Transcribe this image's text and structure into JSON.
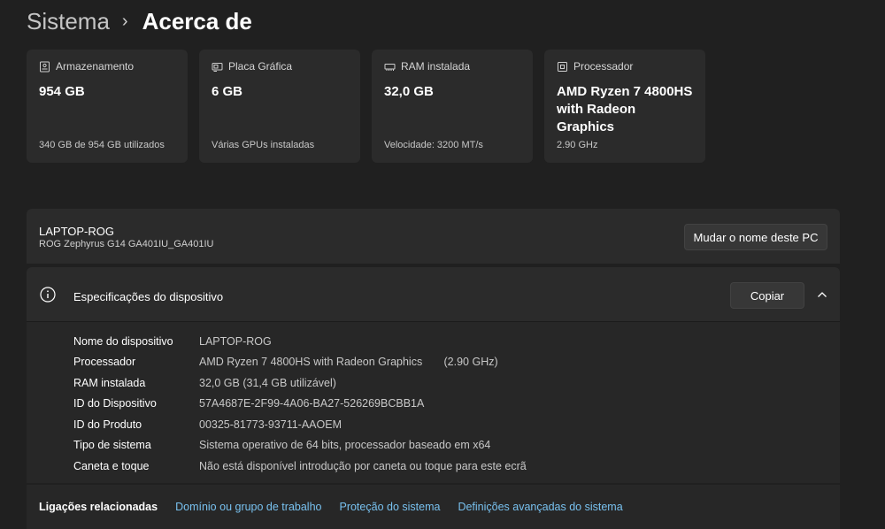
{
  "breadcrumb": {
    "parent": "Sistema",
    "separator": "›",
    "current": "Acerca de"
  },
  "cards": [
    {
      "icon": "storage-icon",
      "title": "Armazenamento",
      "value": "954 GB",
      "sub": "340 GB de 954 GB utilizados"
    },
    {
      "icon": "graphics-card-icon",
      "title": "Placa Gráfica",
      "value": "6 GB",
      "sub": "Várias GPUs instaladas"
    },
    {
      "icon": "ram-icon",
      "title": "RAM instalada",
      "value": "32,0 GB",
      "sub": "Velocidade: 3200 MT/s"
    },
    {
      "icon": "processor-icon",
      "title": "Processador",
      "value": "AMD Ryzen 7 4800HS with Radeon Graphics",
      "sub": "2.90 GHz"
    }
  ],
  "device": {
    "name": "LAPTOP-ROG",
    "model": "ROG Zephyrus G14 GA401IU_GA401IU",
    "rename_label": "Mudar o nome deste PC"
  },
  "specs": {
    "title": "Especificações do dispositivo",
    "copy_label": "Copiar",
    "rows": [
      {
        "label": "Nome do dispositivo",
        "value": "LAPTOP-ROG"
      },
      {
        "label": "Processador",
        "value": "AMD Ryzen 7 4800HS with Radeon Graphics       (2.90 GHz)"
      },
      {
        "label": "RAM instalada",
        "value": "32,0 GB (31,4 GB utilizável)"
      },
      {
        "label": "ID do Dispositivo",
        "value": "57A4687E-2F99-4A06-BA27-526269BCBB1A"
      },
      {
        "label": "ID do Produto",
        "value": "00325-81773-93711-AAOEM"
      },
      {
        "label": "Tipo de sistema",
        "value": "Sistema operativo de 64 bits, processador baseado em x64"
      },
      {
        "label": "Caneta e toque",
        "value": "Não está disponível introdução por caneta ou toque para este ecrã"
      }
    ]
  },
  "related": {
    "title": "Ligações relacionadas",
    "links": [
      "Domínio ou grupo de trabalho",
      "Proteção do sistema",
      "Definições avançadas do sistema"
    ]
  },
  "colors": {
    "background": "#202020",
    "card": "#2b2b2b",
    "link": "#78c1ef"
  }
}
